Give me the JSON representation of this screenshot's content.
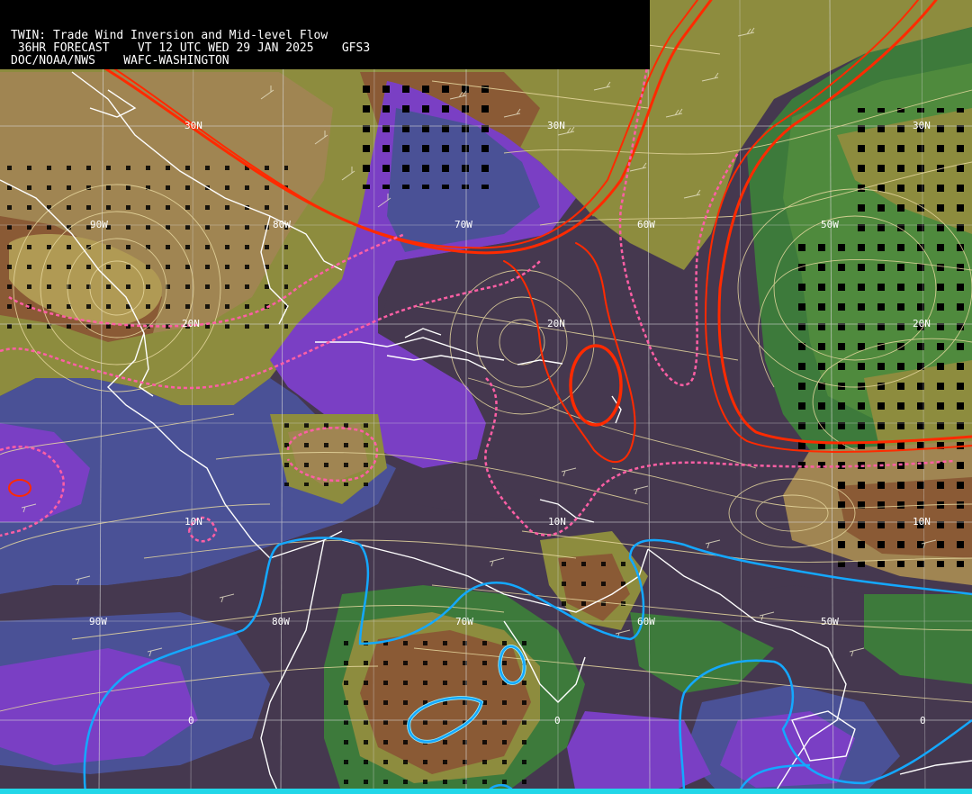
{
  "header": {
    "title": "TWIN: Trade Wind Inversion and Mid-level Flow",
    "forecast": " 36HR FORECAST    VT 12 UTC WED 29 JAN 2025    GFS3",
    "source": "DOC/NOAA/NWS    WAFC-WASHINGTON"
  },
  "grid_labels": {
    "lat30n_a": "30N",
    "lat30n_b": "30N",
    "lat30n_c": "30N",
    "lat20n_a": "20N",
    "lat20n_b": "20N",
    "lat20n_c": "20N",
    "lat10n_a": "10N",
    "lat10n_b": "10N",
    "lat10n_c": "10N",
    "lon90w_top": "90W",
    "lon80w_top": "80W",
    "lon70w_top": "70W",
    "lon60w_top": "60W",
    "lon50w_top": "50W",
    "lon90w_bot": "90W",
    "lon80w_bot": "80W",
    "lon70w_bot": "70W",
    "lon60w_bot": "60W",
    "lon50w_bot": "50W",
    "eq_a": "0",
    "eq_b": "0",
    "eq_c": "0"
  },
  "colors": {
    "dark_purple": "#45384f",
    "violet": "#7a3fc4",
    "slate_blue": "#4a5196",
    "green": "#3d7a3b",
    "olive": "#8d8c3e",
    "tan": "#a08552",
    "brown": "#8a5a35",
    "streamline": "#e8d9a0",
    "contour_red": "#ff2a00",
    "contour_pink": "#ff5fa5",
    "contour_cyan": "#14a8ff",
    "coast_white": "#ffffff"
  }
}
